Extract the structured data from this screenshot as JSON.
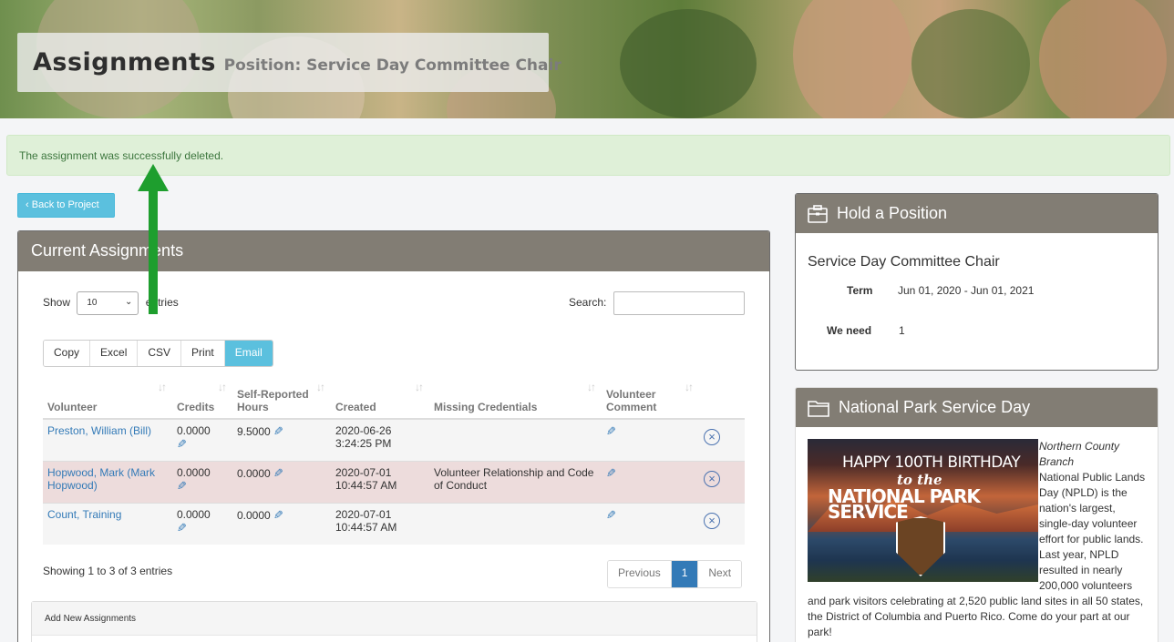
{
  "banner": {
    "title": "Assignments",
    "subtitle": "Position: Service Day Committee Chair"
  },
  "alert": {
    "message": "The assignment was successfully deleted."
  },
  "back_button": {
    "label": "Back to Project",
    "icon": "chevron-left-icon"
  },
  "current_assignments": {
    "heading": "Current Assignments",
    "show_label": "Show",
    "show_value": "10",
    "entries_label": "entries",
    "search_label": "Search:",
    "search_value": "",
    "export_buttons": [
      "Copy",
      "Excel",
      "CSV",
      "Print",
      "Email"
    ],
    "columns": [
      "Volunteer",
      "Credits",
      "Self-Reported Hours",
      "Created",
      "Missing Credentials",
      "Volunteer Comment"
    ],
    "rows": [
      {
        "volunteer": "Preston, William (Bill)",
        "credits": "0.0000",
        "hours": "9.5000",
        "created": "2020-06-26 3:24:25 PM",
        "missing": ""
      },
      {
        "volunteer": "Hopwood, Mark (Mark Hopwood)",
        "credits": "0.0000",
        "hours": "0.0000",
        "created": "2020-07-01 10:44:57 AM",
        "missing": "Volunteer Relationship and Code of Conduct"
      },
      {
        "volunteer": "Count, Training",
        "credits": "0.0000",
        "hours": "0.0000",
        "created": "2020-07-01 10:44:57 AM",
        "missing": ""
      }
    ],
    "showing_text": "Showing 1 to 3 of 3 entries",
    "pager": {
      "previous": "Previous",
      "current": "1",
      "next": "Next"
    }
  },
  "add_new": {
    "heading": "Add New Assignments"
  },
  "hold_position": {
    "heading": "Hold a Position",
    "icon": "briefcase-icon",
    "title": "Service Day Committee Chair",
    "term_label": "Term",
    "term_value": "Jun 01, 2020 - Jun 01, 2021",
    "need_label": "We need",
    "need_value": "1"
  },
  "nps_day": {
    "heading": "National Park Service Day",
    "icon": "folder-icon",
    "image_text": {
      "line1": "HAPPY 100TH BIRTHDAY",
      "line2": "to the",
      "line3": "NATIONAL PARK SERVICE"
    },
    "branch": "Northern County Branch",
    "body": "National Public Lands Day (NPLD) is the nation's largest, single-day volunteer effort for public lands. Last year, NPLD resulted in nearly 200,000 volunteers and park visitors celebrating at 2,520 public land sites in all 50 states, the District of Columbia and Puerto Rico. Come do your part at our park!"
  },
  "colors": {
    "panel_heading": "#827d74",
    "info_button": "#5bc0de",
    "alert_bg": "#dff0d8",
    "danger_row": "#eddcdc",
    "arrow": "#1e9e2e"
  }
}
